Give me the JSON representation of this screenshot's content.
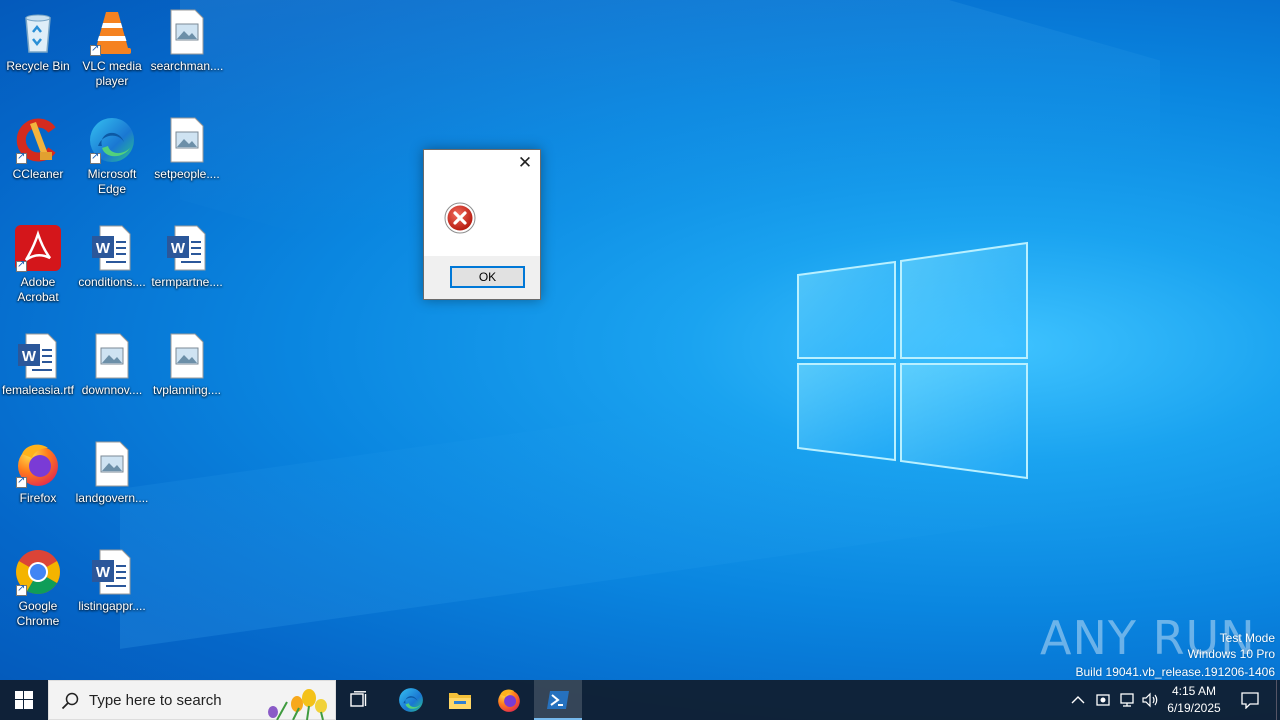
{
  "desktop": {
    "icons": [
      {
        "label": "Recycle Bin",
        "icon": "recycle-bin-icon"
      },
      {
        "label": "VLC media player",
        "icon": "vlc-icon"
      },
      {
        "label": "searchman....",
        "icon": "image-file-icon"
      },
      {
        "label": "CCleaner",
        "icon": "ccleaner-icon"
      },
      {
        "label": "Microsoft Edge",
        "icon": "edge-icon"
      },
      {
        "label": "setpeople....",
        "icon": "image-file-icon"
      },
      {
        "label": "Adobe Acrobat",
        "icon": "acrobat-icon"
      },
      {
        "label": "conditions....",
        "icon": "word-doc-icon"
      },
      {
        "label": "termpartne....",
        "icon": "word-doc-icon"
      },
      {
        "label": "femaleasia.rtf",
        "icon": "word-doc-icon"
      },
      {
        "label": "downnov....",
        "icon": "image-file-icon"
      },
      {
        "label": "tvplanning....",
        "icon": "image-file-icon"
      },
      {
        "label": "Firefox",
        "icon": "firefox-icon"
      },
      {
        "label": "landgovern....",
        "icon": "image-file-icon"
      },
      {
        "label": "Google Chrome",
        "icon": "chrome-icon"
      },
      {
        "label": "listingappr....",
        "icon": "word-doc-icon"
      }
    ]
  },
  "dialog": {
    "close_glyph": "✕",
    "icon": "error-icon",
    "ok_label": "OK"
  },
  "watermark": {
    "brand": "ANY RUN",
    "mode": "Test Mode",
    "edition": "Windows 10 Pro",
    "build": "Build 19041.vb_release.191206-1406"
  },
  "taskbar": {
    "search_placeholder": "Type here to search",
    "apps": [
      "task-view-icon",
      "edge-icon",
      "file-explorer-icon",
      "firefox-icon",
      "powershell-icon"
    ],
    "time": "4:15 AM",
    "date": "6/19/2025"
  },
  "colors": {
    "taskbar": "#101c2c",
    "accent": "#0078d7",
    "error_red": "#c42b1c"
  }
}
